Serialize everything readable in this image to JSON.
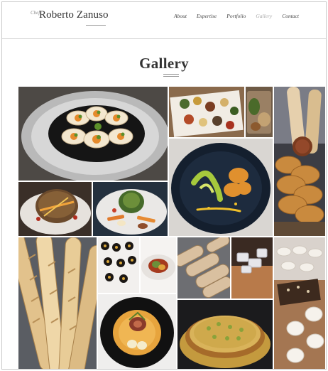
{
  "header": {
    "logo_prefix": "Chef",
    "logo_name": "Roberto Zanuso",
    "nav": [
      {
        "label": "About",
        "active": false
      },
      {
        "label": "Expertise",
        "active": false
      },
      {
        "label": "Portfolio",
        "active": false
      },
      {
        "label": "Gallery",
        "active": true
      },
      {
        "label": "Contact",
        "active": false
      }
    ]
  },
  "main": {
    "title": "Gallery"
  },
  "gallery": {
    "images": [
      "oysters-plate",
      "canapes-platter",
      "bread-loaves",
      "seafood-plate-dark",
      "braided-bread",
      "terrine-plate",
      "vegetable-plate",
      "baguettes",
      "chocolate-pralines",
      "small-dish",
      "bread-rolls",
      "sugar-pieces",
      "macarons",
      "roulade-plate",
      "quiche-tart"
    ]
  }
}
